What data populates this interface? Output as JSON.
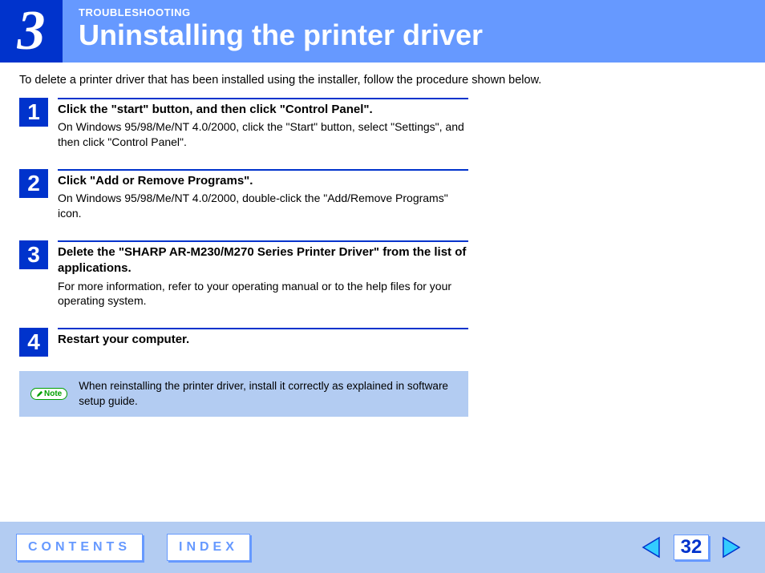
{
  "header": {
    "chapter_number": "3",
    "section_label": "TROUBLESHOOTING",
    "title": "Uninstalling the printer driver"
  },
  "intro": "To delete a printer driver that has been installed using the installer, follow the procedure shown below.",
  "steps": [
    {
      "num": "1",
      "title": "Click the \"start\" button, and then click \"Control Panel\".",
      "desc": "On Windows 95/98/Me/NT 4.0/2000, click the \"Start\" button, select \"Settings\", and then click \"Control Panel\"."
    },
    {
      "num": "2",
      "title": "Click \"Add or Remove Programs\".",
      "desc": "On Windows 95/98/Me/NT 4.0/2000, double-click the \"Add/Remove Programs\" icon."
    },
    {
      "num": "3",
      "title": "Delete the \"SHARP AR-M230/M270 Series Printer Driver\" from the list of applications.",
      "desc": "For more information, refer to your operating manual or to the help files for your operating system."
    },
    {
      "num": "4",
      "title": "Restart your computer.",
      "desc": ""
    }
  ],
  "note": {
    "badge": "Note",
    "text": "When reinstalling the printer driver, install it correctly as explained in software setup guide."
  },
  "footer": {
    "contents": "CONTENTS",
    "index": "INDEX",
    "page": "32"
  }
}
